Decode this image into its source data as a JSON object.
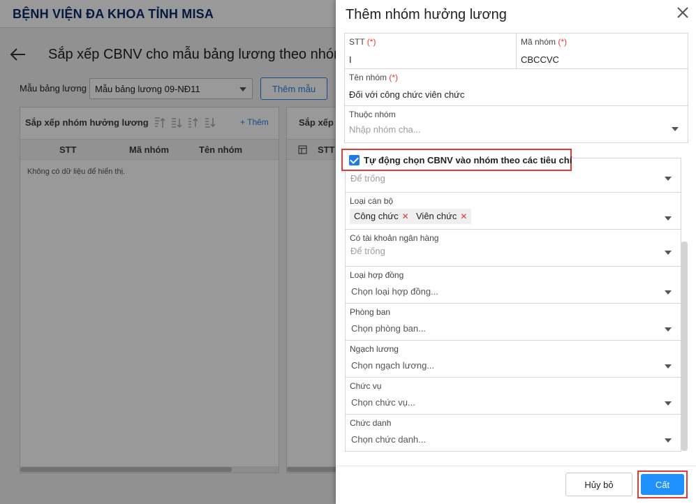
{
  "app": {
    "title": "BỆNH VIỆN ĐA KHOA TỈNH MISA"
  },
  "page": {
    "title": "Sắp xếp CBNV cho mẫu bảng lương theo nhóm",
    "template_label": "Mẫu bảng lương",
    "template_value": "Mẫu bảng lương 09-NĐ11",
    "add_template_button": "Thêm mẫu"
  },
  "left_panel": {
    "title": "Sắp xếp nhóm hưởng lương",
    "add_link": "+ Thêm",
    "columns": [
      "STT",
      "Mã nhóm",
      "Tên nhóm"
    ],
    "empty_text": "Không có dữ liệu để hiển thị."
  },
  "right_panel": {
    "title": "Sắp xếp c",
    "columns": [
      "STT"
    ]
  },
  "dialog": {
    "title": "Thêm nhóm hưởng lương",
    "stt": {
      "label": "STT",
      "required": "(*)",
      "value": "I"
    },
    "ma_nhom": {
      "label": "Mã nhóm",
      "required": "(*)",
      "value": "CBCCVC"
    },
    "ten_nhom": {
      "label": "Tên nhóm",
      "required": "(*)",
      "value": "Đối với công chức viên chức"
    },
    "thuoc_nhom": {
      "label": "Thuộc nhóm",
      "placeholder": "Nhập nhóm cha..."
    },
    "auto_select": {
      "label": "Tự động chọn CBNV vào nhóm theo các tiêu chí",
      "checked": true
    },
    "criteria": {
      "first": {
        "placeholder": "Để trống"
      },
      "loai_can_bo": {
        "label": "Loại cán bộ",
        "chips": [
          "Công chức",
          "Viên chức"
        ]
      },
      "tai_khoan": {
        "label": "Có tài khoản ngân hàng",
        "placeholder": "Để trống"
      },
      "loai_hop_dong": {
        "label": "Loại hợp đồng",
        "placeholder": "Chọn loại hợp đồng..."
      },
      "phong_ban": {
        "label": "Phòng ban",
        "placeholder": "Chọn phòng ban..."
      },
      "ngach_luong": {
        "label": "Ngạch lương",
        "placeholder": "Chọn ngạch lương..."
      },
      "chuc_vu": {
        "label": "Chức vụ",
        "placeholder": "Chọn chức vụ..."
      },
      "chuc_danh": {
        "label": "Chức danh",
        "placeholder": "Chọn chức danh..."
      }
    },
    "cancel_button": "Hủy bỏ",
    "save_button": "Cất"
  },
  "colors": {
    "primary": "#1e90ff",
    "required": "#e53935",
    "header_title": "#0b2a6b"
  },
  "icons": [
    "arrow-left-icon",
    "move-top-icon",
    "move-up-icon",
    "move-down-icon",
    "move-bottom-icon",
    "grid-icon",
    "close-icon",
    "chevron-down-icon",
    "checkbox-checked-icon",
    "chip-remove-icon"
  ]
}
